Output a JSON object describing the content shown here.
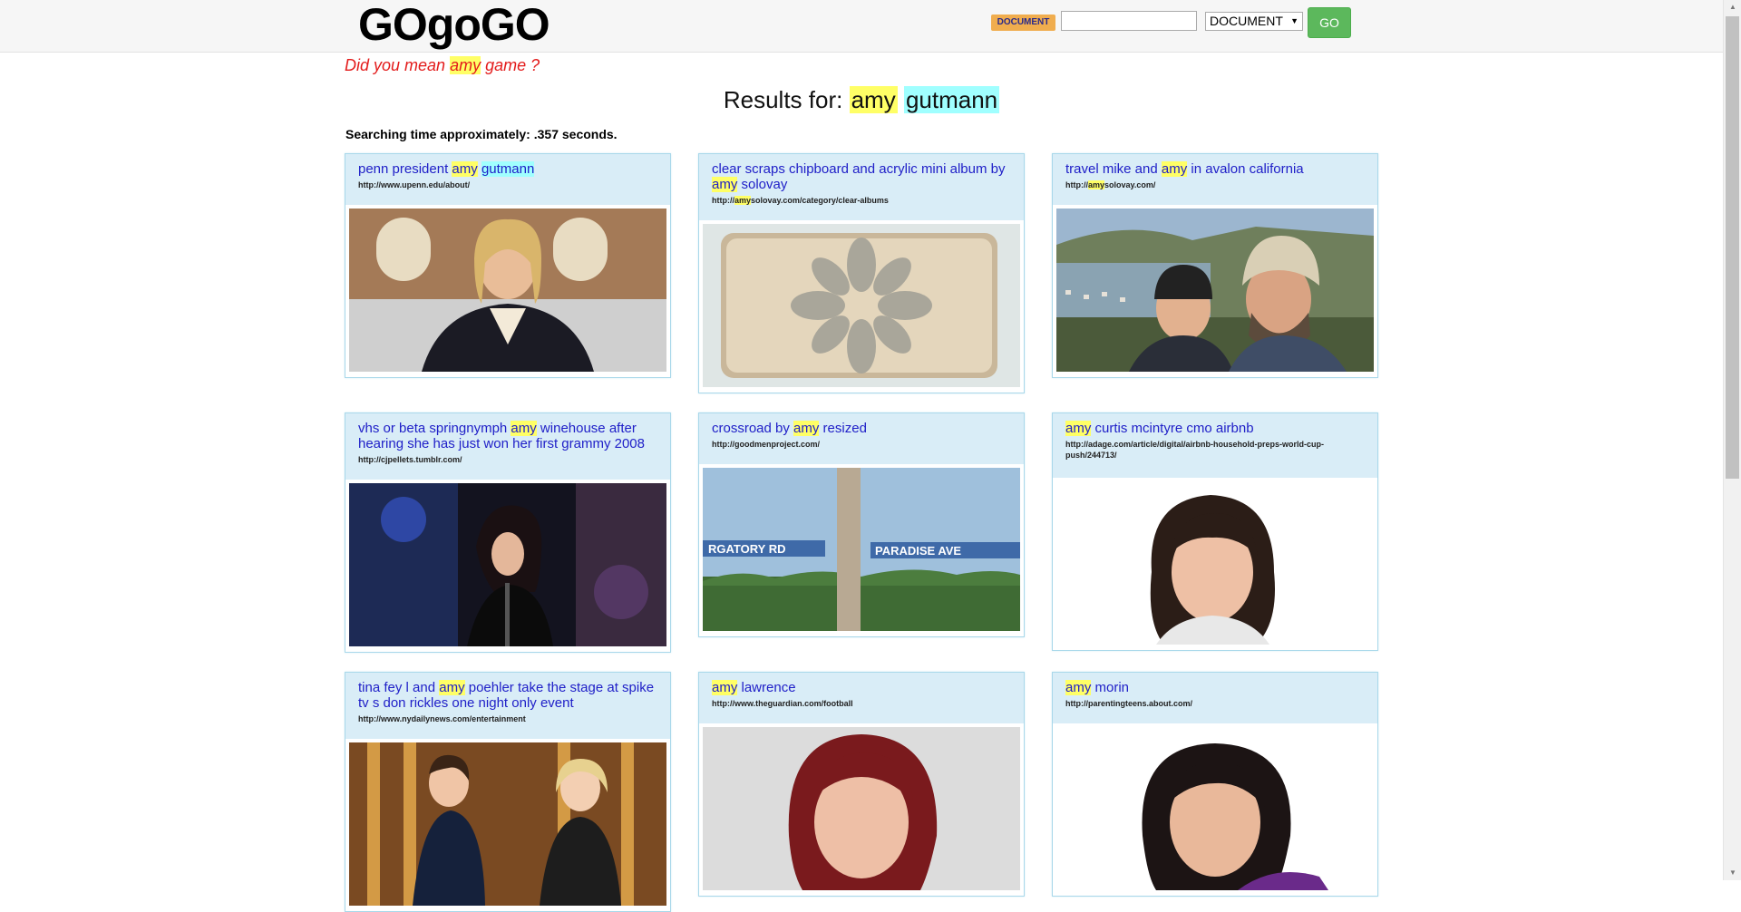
{
  "header": {
    "logo": "GOgoGO",
    "badge_label": "DOCUMENT",
    "search_value": "",
    "type_selected": "DOCUMENT",
    "go_label": "GO"
  },
  "suggestion": {
    "prefix": "Did you mean ",
    "term": "amy",
    "suffix": " game ?"
  },
  "results_title": {
    "prefix": "Results for: ",
    "term1": "amy",
    "term2": "gutmann"
  },
  "search_time": "Searching time approximately: .357 seconds.",
  "colors": {
    "highlight_yellow": "#ffff66",
    "highlight_cyan": "#a0ffff",
    "link_blue": "#2020c8",
    "suggestion_red": "#e31b1b",
    "card_header": "#d9edf7",
    "go_green": "#5cb85c",
    "badge_orange": "#f0ad4e"
  },
  "results": [
    {
      "title_parts": [
        "penn president ",
        "amy",
        " ",
        "gutmann",
        ""
      ],
      "url": "http://www.upenn.edu/about/",
      "image": "woman-portrait-photo"
    },
    {
      "title_parts": [
        "clear scraps chipboard and acrylic mini album by ",
        "amy",
        " solovay",
        "",
        ""
      ],
      "url_prefix": "http://",
      "url_term": "amy",
      "url_suffix": "solovay.com/category/clear-albums",
      "image": "flower-album-photo"
    },
    {
      "title_parts": [
        "travel mike and ",
        "amy",
        " in avalon california",
        "",
        ""
      ],
      "url_prefix": "http://",
      "url_term": "amy",
      "url_suffix": "solovay.com/",
      "image": "couple-selfie-photo"
    },
    {
      "title_parts": [
        "vhs or beta springnymph ",
        "amy",
        " winehouse after hearing she has just won her first grammy 2008",
        "",
        ""
      ],
      "url": "http://cjpellets.tumblr.com/",
      "image": "singer-stage-photo"
    },
    {
      "title_parts": [
        "crossroad by ",
        "amy",
        " resized",
        "",
        ""
      ],
      "url": "http://goodmenproject.com/",
      "image": "street-sign-photo",
      "sign_left": "RGATORY RD",
      "sign_right": "PARADISE AVE"
    },
    {
      "title_parts": [
        "",
        "amy",
        " curtis mcintyre cmo airbnb",
        "",
        ""
      ],
      "url": "http://adage.com/article/digital/airbnb-household-preps-world-cup-push/244713/",
      "image": "woman-headshot-photo"
    },
    {
      "title_parts": [
        "tina fey l and ",
        "amy",
        " poehler take the stage at spike tv s don rickles one night only event",
        "",
        ""
      ],
      "url": "http://www.nydailynews.com/entertainment",
      "image": "two-women-stage-photo"
    },
    {
      "title_parts": [
        "",
        "amy",
        " lawrence",
        "",
        ""
      ],
      "url": "http://www.theguardian.com/football",
      "image": "red-hair-woman-photo"
    },
    {
      "title_parts": [
        "",
        "amy",
        " morin",
        "",
        ""
      ],
      "url": "http://parentingteens.about.com/",
      "image": "dark-hair-woman-photo"
    }
  ]
}
